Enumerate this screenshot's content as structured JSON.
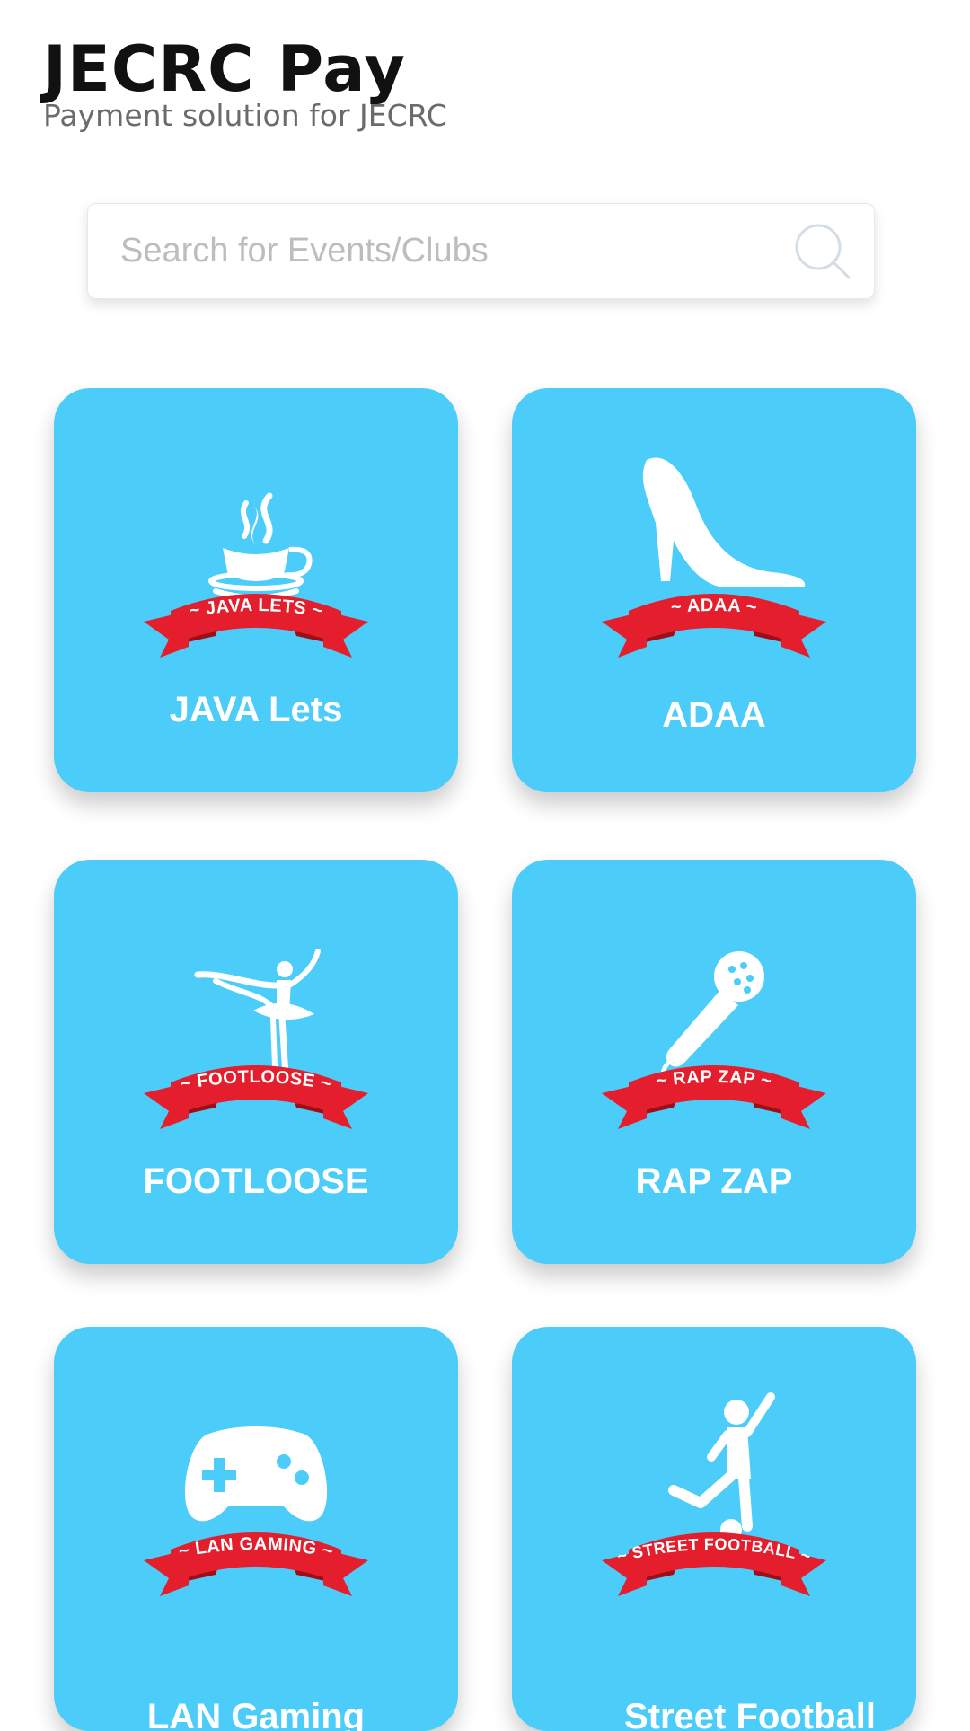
{
  "header": {
    "title": "JECRC Pay",
    "subtitle": "Payment solution for JECRC"
  },
  "search": {
    "placeholder": "Search for Events/Clubs",
    "value": ""
  },
  "colors": {
    "tile_background": "#4ccdf9",
    "banner_red": "#e41e2c",
    "banner_dark_red": "#9a0f18"
  },
  "events": [
    {
      "label": "JAVA Lets",
      "banner": "~ JAVA LETS ~",
      "icon": "java-coffee-cup-icon"
    },
    {
      "label": "ADAA",
      "banner": "~ ADAA ~",
      "icon": "high-heel-shoe-icon"
    },
    {
      "label": "FOOTLOOSE",
      "banner": "~ FOOTLOOSE ~",
      "icon": "ballerina-icon"
    },
    {
      "label": "RAP ZAP",
      "banner": "~ RAP ZAP ~",
      "icon": "microphone-icon"
    },
    {
      "label": "LAN Gaming",
      "banner": "~ LAN GAMING ~",
      "icon": "gamepad-icon"
    },
    {
      "label": "Street Football",
      "banner": "~ STREET FOOTBALL ~",
      "icon": "football-player-icon"
    }
  ]
}
